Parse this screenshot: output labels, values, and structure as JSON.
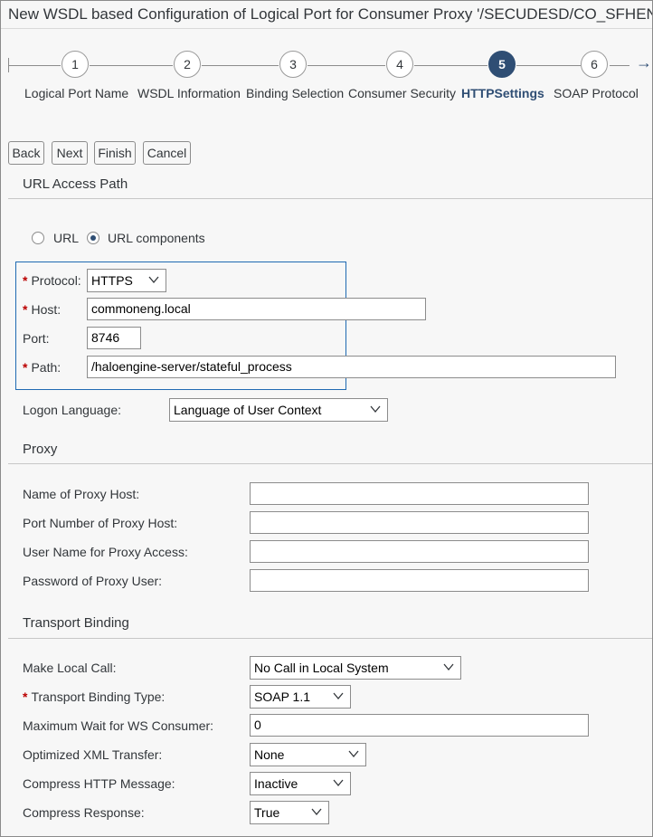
{
  "window": {
    "title": "New WSDL based Configuration of Logical Port for Consumer Proxy '/SECUDESD/CO_SFHENG'"
  },
  "wizard": {
    "steps": [
      {
        "number": "1",
        "label": "Logical Port Name"
      },
      {
        "number": "2",
        "label": "WSDL Information"
      },
      {
        "number": "3",
        "label": "Binding Selection"
      },
      {
        "number": "4",
        "label": "Consumer Security"
      },
      {
        "number": "5",
        "label": "HTTPSettings"
      },
      {
        "number": "6",
        "label": "SOAP Protocol"
      }
    ],
    "active_step": "5",
    "next_arrow": "→"
  },
  "toolbar": {
    "back": "Back",
    "next": "Next",
    "finish": "Finish",
    "cancel": "Cancel"
  },
  "url_access": {
    "heading": "URL Access Path",
    "radio_url": "URL",
    "radio_components": "URL components",
    "selected": "URL components",
    "protocol_label": "Protocol:",
    "protocol_value": "HTTPS",
    "host_label": "Host:",
    "host_value": "commoneng.local",
    "port_label": "Port:",
    "port_value": "8746",
    "path_label": "Path:",
    "path_value": "/haloengine-server/stateful_process",
    "logon_label": "Logon Language:",
    "logon_value": "Language of User Context"
  },
  "proxy": {
    "heading": "Proxy",
    "host_label": "Name of Proxy Host:",
    "host_value": "",
    "port_label": "Port Number of Proxy Host:",
    "port_value": "",
    "user_label": "User Name for Proxy Access:",
    "user_value": "",
    "password_label": "Password of Proxy User:",
    "password_value": ""
  },
  "transport": {
    "heading": "Transport Binding",
    "local_call_label": "Make Local Call:",
    "local_call_value": "No Call in Local System",
    "binding_type_label": "Transport Binding Type:",
    "binding_type_value": "SOAP 1.1",
    "max_wait_label": "Maximum Wait for WS Consumer:",
    "max_wait_value": "0",
    "xml_label": "Optimized XML Transfer:",
    "xml_value": "None",
    "compress_msg_label": "Compress HTTP Message:",
    "compress_msg_value": "Inactive",
    "compress_resp_label": "Compress Response:",
    "compress_resp_value": "True"
  },
  "colors": {
    "accent": "#2f4e74",
    "required": "#bb0000",
    "focus_border": "#1f6ab2"
  }
}
